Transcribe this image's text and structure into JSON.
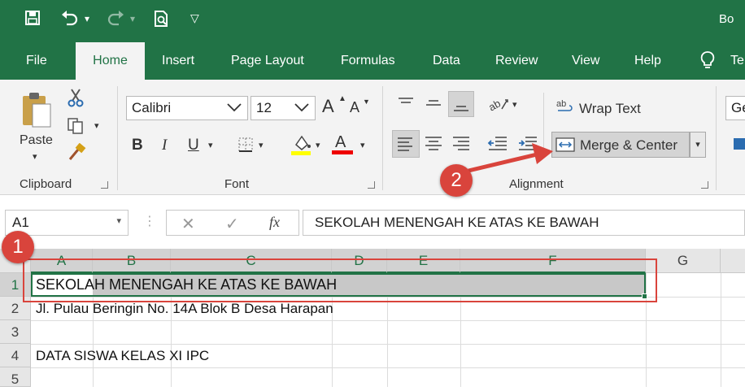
{
  "titlebar": {
    "title": "Bo"
  },
  "tabs": {
    "file": "File",
    "home": "Home",
    "insert": "Insert",
    "page_layout": "Page Layout",
    "formulas": "Formulas",
    "data": "Data",
    "review": "Review",
    "view": "View",
    "help": "Help",
    "tell": "Te"
  },
  "ribbon": {
    "clipboard": {
      "paste": "Paste",
      "label": "Clipboard"
    },
    "font": {
      "name": "Calibri",
      "size": "12",
      "label": "Font",
      "bold": "B",
      "italic": "I",
      "underline": "U",
      "grow": "A",
      "shrink": "A",
      "font_color": "A"
    },
    "alignment": {
      "wrap_text": "Wrap Text",
      "merge_center": "Merge & Center",
      "label": "Alignment"
    },
    "number": {
      "format": "Ge"
    }
  },
  "formula_bar": {
    "name_box": "A1",
    "fx": "fx",
    "content": "SEKOLAH MENENGAH KE ATAS KE BAWAH"
  },
  "grid": {
    "columns": [
      "A",
      "B",
      "C",
      "D",
      "E",
      "F",
      "G"
    ],
    "rows": [
      "1",
      "2",
      "3",
      "4",
      "5"
    ],
    "cells": {
      "r1": "SEKOLAH MENENGAH KE ATAS KE BAWAH",
      "r2": "Jl. Pulau Beringin No. 14A Blok B Desa Harapan",
      "r3": "",
      "r4": "DATA SISWA KELAS XI IPC",
      "r5": ""
    }
  },
  "annotations": {
    "step1": "1",
    "step2": "2"
  },
  "colors": {
    "excel_green": "#217346",
    "annotation_red": "#d9443c"
  }
}
